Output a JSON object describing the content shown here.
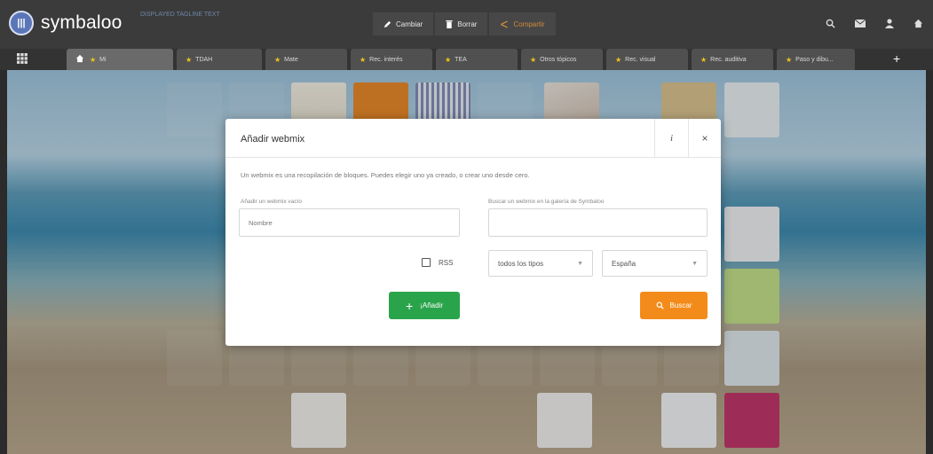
{
  "app": {
    "name": "symbaloo",
    "tagline": "DISPLAYED TAGLINE TEXT"
  },
  "topbar": {
    "actions": [
      {
        "label": "Cambiar",
        "icon": "pencil-icon"
      },
      {
        "label": "Borrar",
        "icon": "trash-icon"
      },
      {
        "label": "Compartir",
        "icon": "share-icon"
      }
    ],
    "icons": [
      "search-icon",
      "mail-icon",
      "user-icon",
      "home-icon"
    ]
  },
  "tabs": [
    {
      "label": "Mi",
      "active": true,
      "home": true
    },
    {
      "label": "TDAH"
    },
    {
      "label": "Mate"
    },
    {
      "label": "Rec. interés"
    },
    {
      "label": "TEA"
    },
    {
      "label": "Otros tópicos"
    },
    {
      "label": "Rec. visual"
    },
    {
      "label": "Rec. auditiva"
    },
    {
      "label": "Paso y dibu..."
    }
  ],
  "dialog": {
    "title": "Añadir webmix",
    "info_label": "i",
    "close_label": "×",
    "description": "Un webmix es una recopilación de bloques. Puedes elegir uno ya creado, o crear uno desde cero.",
    "left": {
      "label": "Añadir un webmix vacío",
      "name_placeholder": "Nombre",
      "rss_label": "RSS",
      "add_button": "¡Añadir"
    },
    "right": {
      "label": "Buscar un webmix en la galería de Symbaloo",
      "search_placeholder": "",
      "type_select": "todos los tipos",
      "country_select": "España",
      "search_button": "Buscar"
    }
  },
  "colors": {
    "accent_green": "#2aa44b",
    "accent_orange": "#f38b1a",
    "topbar": "#3b3b3b"
  }
}
